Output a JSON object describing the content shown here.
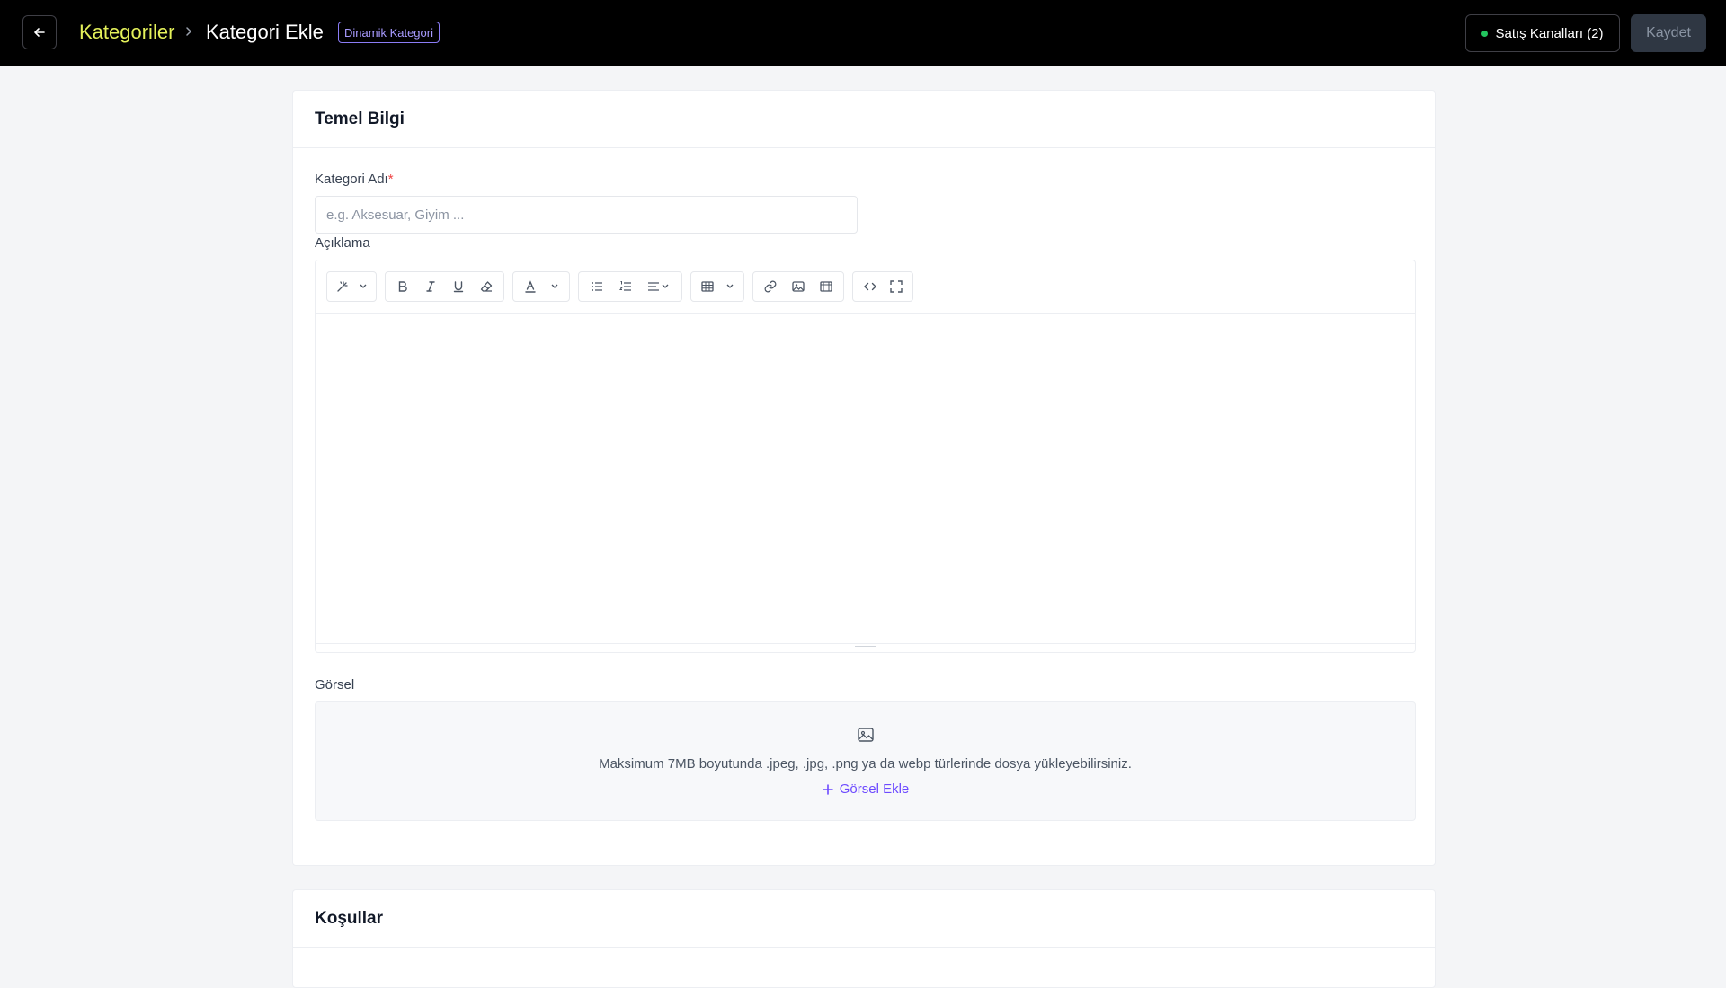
{
  "header": {
    "breadcrumb_root": "Kategoriler",
    "title": "Kategori Ekle",
    "badge": "Dinamik Kategori",
    "channels_label": "Satış Kanalları (2)",
    "save_label": "Kaydet"
  },
  "basic_info": {
    "title": "Temel Bilgi",
    "name_label": "Kategori Adı",
    "required_mark": "*",
    "name_placeholder": "e.g. Aksesuar, Giyim ...",
    "name_value": "",
    "description_label": "Açıklama",
    "toolbar_icons": [
      "magic-icon",
      "bold-icon",
      "italic-icon",
      "underline-icon",
      "eraser-icon",
      "font-color-icon",
      "bullet-list-icon",
      "numbered-list-icon",
      "align-icon",
      "table-icon",
      "link-icon",
      "image-icon",
      "video-icon",
      "code-view-icon",
      "fullscreen-icon"
    ],
    "image_label": "Görsel",
    "upload_hint": "Maksimum 7MB boyutunda .jpeg, .jpg, .png ya da webp türlerinde dosya yükleyebilirsiniz.",
    "upload_link": "Görsel Ekle"
  },
  "conditions": {
    "title": "Koşullar"
  },
  "colors": {
    "topbar_bg": "#000000",
    "breadcrumb_accent": "#e4f15a",
    "badge_accent": "#8b7cf6",
    "link_accent": "#6d4aff",
    "status_dot": "#22c55e"
  }
}
